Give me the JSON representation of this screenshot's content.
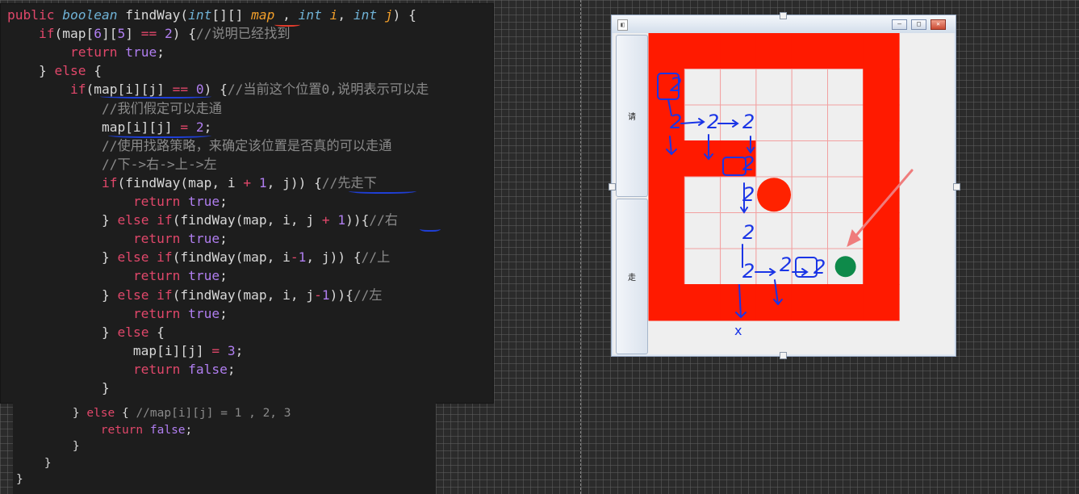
{
  "code": {
    "lines": [
      [
        {
          "t": "public ",
          "c": "kw"
        },
        {
          "t": "boolean ",
          "c": "ty"
        },
        {
          "t": "findWay(",
          "c": "fn"
        },
        {
          "t": "int",
          "c": "ty"
        },
        {
          "t": "[][] ",
          "c": "fn"
        },
        {
          "t": "map",
          "c": "pm"
        },
        {
          "t": " , ",
          "c": "fn"
        },
        {
          "t": "int ",
          "c": "ty"
        },
        {
          "t": "i",
          "c": "pm"
        },
        {
          "t": ", ",
          "c": "fn"
        },
        {
          "t": "int ",
          "c": "ty"
        },
        {
          "t": "j",
          "c": "pm"
        },
        {
          "t": ") {",
          "c": "fn"
        }
      ],
      [
        {
          "t": "    ",
          "c": "fn"
        },
        {
          "t": "if",
          "c": "kw"
        },
        {
          "t": "(map[",
          "c": "fn"
        },
        {
          "t": "6",
          "c": "nu"
        },
        {
          "t": "][",
          "c": "fn"
        },
        {
          "t": "5",
          "c": "nu"
        },
        {
          "t": "] ",
          "c": "fn"
        },
        {
          "t": "==",
          "c": "op"
        },
        {
          "t": " ",
          "c": "fn"
        },
        {
          "t": "2",
          "c": "nu"
        },
        {
          "t": ") {",
          "c": "fn"
        },
        {
          "t": "//说明已经找到",
          "c": "cm"
        }
      ],
      [
        {
          "t": "        ",
          "c": "fn"
        },
        {
          "t": "return ",
          "c": "kw"
        },
        {
          "t": "true",
          "c": "nu"
        },
        {
          "t": ";",
          "c": "fn"
        }
      ],
      [
        {
          "t": "    } ",
          "c": "fn"
        },
        {
          "t": "else",
          "c": "kw"
        },
        {
          "t": " {",
          "c": "fn"
        }
      ],
      [
        {
          "t": "        ",
          "c": "fn"
        },
        {
          "t": "if",
          "c": "kw"
        },
        {
          "t": "(map[i][j] ",
          "c": "fn"
        },
        {
          "t": "==",
          "c": "op"
        },
        {
          "t": " ",
          "c": "fn"
        },
        {
          "t": "0",
          "c": "nu"
        },
        {
          "t": ") {",
          "c": "fn"
        },
        {
          "t": "//当前这个位置0,说明表示可以走",
          "c": "cm"
        }
      ],
      [
        {
          "t": "            ",
          "c": "fn"
        },
        {
          "t": "//我们假定可以走通",
          "c": "cm"
        }
      ],
      [
        {
          "t": "            map[i][j] ",
          "c": "fn"
        },
        {
          "t": "=",
          "c": "op"
        },
        {
          "t": " ",
          "c": "fn"
        },
        {
          "t": "2",
          "c": "nu"
        },
        {
          "t": ";",
          "c": "fn"
        }
      ],
      [
        {
          "t": "            ",
          "c": "fn"
        },
        {
          "t": "//使用找路策略，来确定该位置是否真的可以走通",
          "c": "cm"
        }
      ],
      [
        {
          "t": "            ",
          "c": "fn"
        },
        {
          "t": "//下->右->上->左",
          "c": "cm"
        }
      ],
      [
        {
          "t": "            ",
          "c": "fn"
        },
        {
          "t": "if",
          "c": "kw"
        },
        {
          "t": "(findWay(map, i ",
          "c": "fn"
        },
        {
          "t": "+",
          "c": "op"
        },
        {
          "t": " ",
          "c": "fn"
        },
        {
          "t": "1",
          "c": "nu"
        },
        {
          "t": ", j)) {",
          "c": "fn"
        },
        {
          "t": "//先走下",
          "c": "cm"
        }
      ],
      [
        {
          "t": "                ",
          "c": "fn"
        },
        {
          "t": "return ",
          "c": "kw"
        },
        {
          "t": "true",
          "c": "nu"
        },
        {
          "t": ";",
          "c": "fn"
        }
      ],
      [
        {
          "t": "            } ",
          "c": "fn"
        },
        {
          "t": "else if",
          "c": "kw"
        },
        {
          "t": "(findWay(map, i, j ",
          "c": "fn"
        },
        {
          "t": "+",
          "c": "op"
        },
        {
          "t": " ",
          "c": "fn"
        },
        {
          "t": "1",
          "c": "nu"
        },
        {
          "t": ")){",
          "c": "fn"
        },
        {
          "t": "//右",
          "c": "cm"
        }
      ],
      [
        {
          "t": "                ",
          "c": "fn"
        },
        {
          "t": "return ",
          "c": "kw"
        },
        {
          "t": "true",
          "c": "nu"
        },
        {
          "t": ";",
          "c": "fn"
        }
      ],
      [
        {
          "t": "            } ",
          "c": "fn"
        },
        {
          "t": "else if",
          "c": "kw"
        },
        {
          "t": "(findWay(map, i",
          "c": "fn"
        },
        {
          "t": "-",
          "c": "op"
        },
        {
          "t": "1",
          "c": "nu"
        },
        {
          "t": ", j)) {",
          "c": "fn"
        },
        {
          "t": "//上",
          "c": "cm"
        }
      ],
      [
        {
          "t": "                ",
          "c": "fn"
        },
        {
          "t": "return ",
          "c": "kw"
        },
        {
          "t": "true",
          "c": "nu"
        },
        {
          "t": ";",
          "c": "fn"
        }
      ],
      [
        {
          "t": "            } ",
          "c": "fn"
        },
        {
          "t": "else if",
          "c": "kw"
        },
        {
          "t": "(findWay(map, i, j",
          "c": "fn"
        },
        {
          "t": "-",
          "c": "op"
        },
        {
          "t": "1",
          "c": "nu"
        },
        {
          "t": ")){",
          "c": "fn"
        },
        {
          "t": "//左",
          "c": "cm"
        }
      ],
      [
        {
          "t": "                ",
          "c": "fn"
        },
        {
          "t": "return ",
          "c": "kw"
        },
        {
          "t": "true",
          "c": "nu"
        },
        {
          "t": ";",
          "c": "fn"
        }
      ],
      [
        {
          "t": "            } ",
          "c": "fn"
        },
        {
          "t": "else",
          "c": "kw"
        },
        {
          "t": " {",
          "c": "fn"
        }
      ],
      [
        {
          "t": "                map[i][j] ",
          "c": "fn"
        },
        {
          "t": "=",
          "c": "op"
        },
        {
          "t": " ",
          "c": "fn"
        },
        {
          "t": "3",
          "c": "nu"
        },
        {
          "t": ";",
          "c": "fn"
        }
      ],
      [
        {
          "t": "                ",
          "c": "fn"
        },
        {
          "t": "return ",
          "c": "kw"
        },
        {
          "t": "false",
          "c": "nu"
        },
        {
          "t": ";",
          "c": "fn"
        }
      ],
      [
        {
          "t": "            }",
          "c": "fn"
        }
      ]
    ],
    "lines2": [
      [
        {
          "t": "        } ",
          "c": "fn"
        },
        {
          "t": "else",
          "c": "kw"
        },
        {
          "t": " { ",
          "c": "fn"
        },
        {
          "t": "//map[i][j] = 1 , 2, 3",
          "c": "cm"
        }
      ],
      [
        {
          "t": "            ",
          "c": "fn"
        },
        {
          "t": "return ",
          "c": "kw"
        },
        {
          "t": "false",
          "c": "nu"
        },
        {
          "t": ";",
          "c": "fn"
        }
      ],
      [
        {
          "t": "        }",
          "c": "fn"
        }
      ],
      [
        {
          "t": "    }",
          "c": "fn"
        }
      ],
      [
        {
          "t": "}",
          "c": "fn"
        }
      ]
    ]
  },
  "window": {
    "side_buttons": [
      "请",
      "走"
    ],
    "title_icon": "app-icon",
    "maze": {
      "rows": 8,
      "cols": 7,
      "walls": [
        [
          1,
          1,
          1,
          1,
          1,
          1,
          1
        ],
        [
          1,
          0,
          0,
          0,
          0,
          0,
          1
        ],
        [
          1,
          0,
          0,
          0,
          0,
          0,
          1
        ],
        [
          1,
          1,
          1,
          0,
          0,
          0,
          1
        ],
        [
          1,
          0,
          0,
          0,
          0,
          0,
          1
        ],
        [
          1,
          0,
          0,
          0,
          0,
          0,
          1
        ],
        [
          1,
          0,
          0,
          0,
          0,
          0,
          1
        ],
        [
          1,
          1,
          1,
          1,
          1,
          1,
          1
        ]
      ],
      "wall_color": "#ff1a00",
      "open_color": "#efefef",
      "grid_color": "#f2a0a0",
      "red_ball": {
        "row": 4,
        "col": 3,
        "color": "#ff2200"
      },
      "green_ball": {
        "row": 6,
        "col": 5,
        "color": "#0e8a4a"
      }
    },
    "annotation_label": "2",
    "annotation_dead_end": "x",
    "annotation_color": "#1a35e6",
    "arrow_color": "#ef7c7c"
  }
}
